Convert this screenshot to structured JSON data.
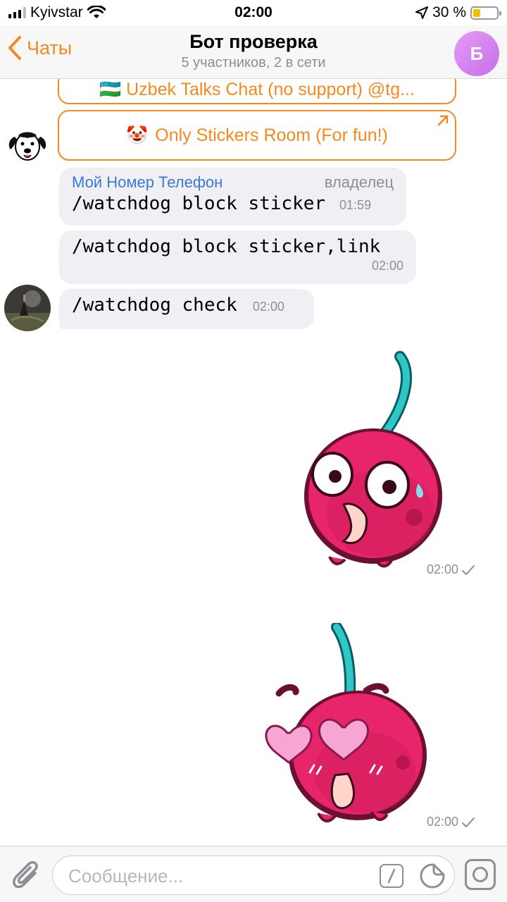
{
  "status_bar": {
    "carrier": "Kyivstar",
    "time": "02:00",
    "battery_percent_text": "30 %",
    "battery_level": 0.3
  },
  "header": {
    "back_label": "Чаты",
    "title": "Бот проверка",
    "subtitle": "5 участников, 2 в сети",
    "avatar_letter": "Б"
  },
  "messages": {
    "inline_button_1": "🇺🇿 Uzbek Talks Chat (no support) @tg...",
    "inline_button_2_emoji": "🤡",
    "inline_button_2": "Only Stickers Room (For fun!)",
    "msg1": {
      "sender": "Мой Номер Телефон",
      "role": "владелец",
      "text": "/watchdog block sticker",
      "time": "01:59"
    },
    "msg2": {
      "text": "/watchdog block sticker,link",
      "time": "02:00"
    },
    "msg3": {
      "text": "/watchdog check",
      "time": "02:00"
    },
    "sticker1": {
      "time": "02:00"
    },
    "sticker2": {
      "time": "02:00"
    }
  },
  "input": {
    "placeholder": "Сообщение..."
  },
  "icons": {
    "back": "chevron-left-icon",
    "attach": "paperclip-icon",
    "command": "slash-command-icon",
    "sticker": "sticker-icon",
    "camera": "camera-icon",
    "check": "checkmark-icon"
  },
  "colors": {
    "accent": "#f5891f",
    "sender_name": "#3b78d8",
    "bubble_bg": "#efeff4",
    "avatar_gradient_start": "#e39cf7",
    "avatar_gradient_end": "#c86ee8"
  }
}
